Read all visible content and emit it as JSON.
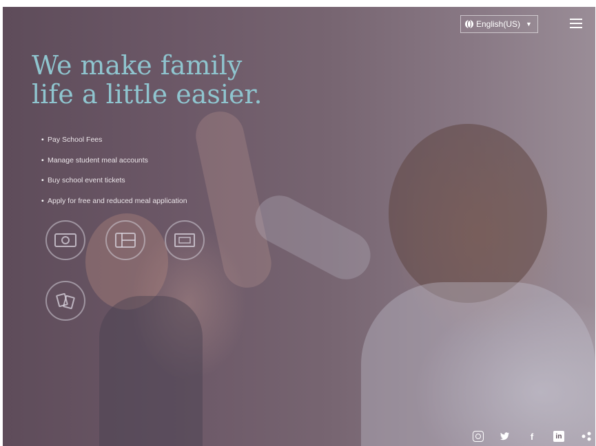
{
  "header": {
    "language_label": "English(US)",
    "language_icon": "globe-icon",
    "menu_icon": "hamburger-menu-icon"
  },
  "hero": {
    "headline_line1": "We make family",
    "headline_line2": "life a little easier.",
    "features": [
      "Pay School Fees",
      "Manage student meal accounts",
      "Buy school event tickets",
      "Apply for free and reduced meal application"
    ],
    "feature_icons": [
      "money-icon",
      "meal-tray-icon",
      "ticket-icon",
      "application-icon"
    ],
    "colors": {
      "headline": "#8fc5cf",
      "text": "#ece6ea",
      "overlay": "#6c5867"
    }
  },
  "footer": {
    "social_icons": [
      "instagram-icon",
      "twitter-icon",
      "facebook-icon",
      "linkedin-icon",
      "share-icon"
    ],
    "facebook_glyph": "f",
    "linkedin_glyph": "in"
  }
}
